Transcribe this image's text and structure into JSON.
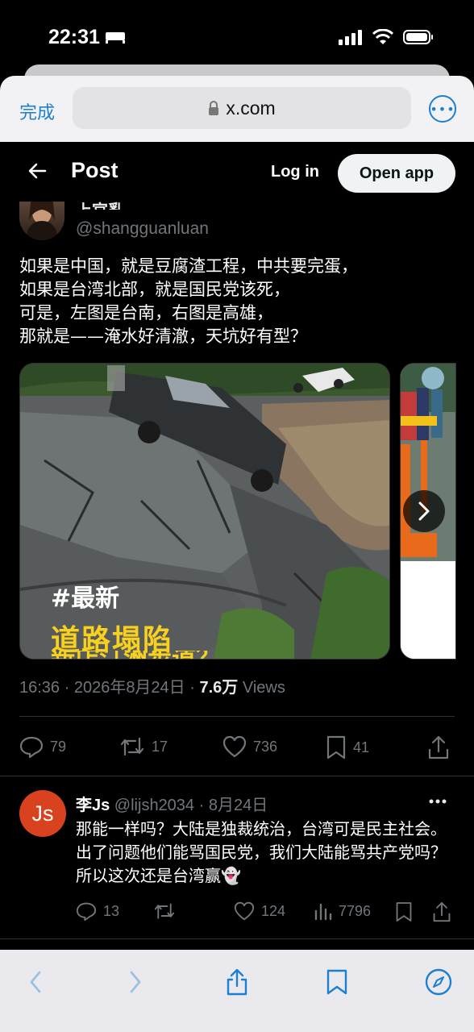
{
  "status_bar": {
    "time": "22:31"
  },
  "browser": {
    "done_label": "完成",
    "url": "x.com",
    "more_label": "•••"
  },
  "header": {
    "back_icon": "arrow-left-icon",
    "title": "Post",
    "login_label": "Log in",
    "open_app_label": "Open app"
  },
  "post": {
    "author_name": "上官亂",
    "handle": "@shangguanluan",
    "text": "如果是中国，就是豆腐渣工程，中共要完蛋，\n如果是台湾北部，就是国民党该死，\n可是，左图是台南，右图是高雄，\n那就是——淹水好清澈，天坑好有型？",
    "media": {
      "tag": "#最新",
      "headline": "道路塌陷",
      "headline_cut": "新店汀洲步道？"
    },
    "time": "16:36 · 2026年8月24日 · ",
    "views_count": "7.6万",
    "views_label": " Views",
    "stats": {
      "replies": "79",
      "reposts": "17",
      "likes": "736",
      "bookmarks": "41"
    }
  },
  "reply": {
    "avatar_text": "Js",
    "name": "李Js",
    "handle_date": " @lijsh2034 · 8月24日",
    "text": "那能一样吗？大陆是独裁统治，台湾可是民主社会。出了问题他们能骂国民党，我们大陆能骂共产党吗？所以这次还是台湾赢👻",
    "stats": {
      "replies": "13",
      "likes": "124",
      "views": "7796"
    }
  },
  "colors": {
    "accent": "#1e7fcf",
    "x_bg": "#000000",
    "muted": "#71767b",
    "headline_yellow": "#f7d11e",
    "reply_avatar": "#d8421e"
  }
}
